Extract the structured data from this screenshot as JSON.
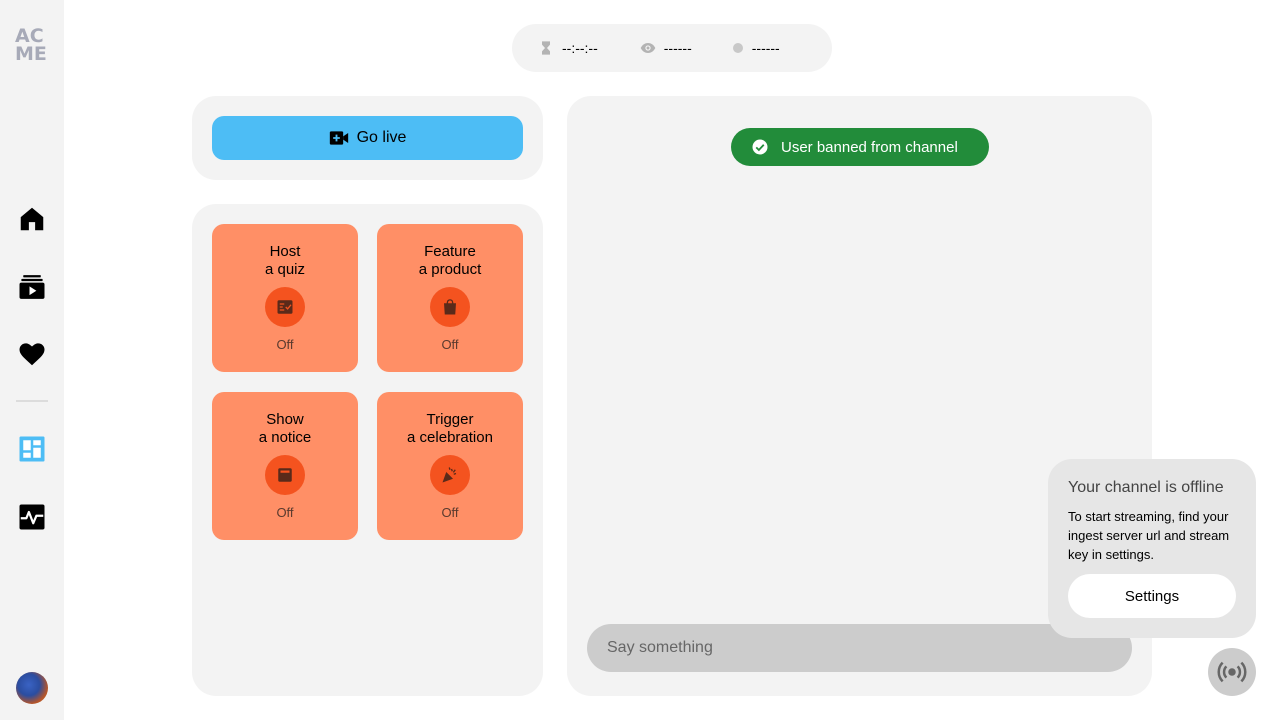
{
  "brand": {
    "logo_line1": "AC",
    "logo_line2": "ME",
    "logo_color": "#a7aab8"
  },
  "sidebar": {
    "items": [
      {
        "name": "home-icon"
      },
      {
        "name": "videos-icon"
      },
      {
        "name": "favorites-icon"
      },
      {
        "name": "dashboard-icon",
        "active": true,
        "color": "#4dbdf5"
      },
      {
        "name": "activity-icon"
      }
    ]
  },
  "stats": {
    "duration": "--:--:--",
    "viewers": "------",
    "status": "------"
  },
  "golive": {
    "label": "Go live",
    "color": "#4dbdf5"
  },
  "actions": [
    {
      "title_line1": "Host",
      "title_line2": "a quiz",
      "state": "Off",
      "icon": "quiz-icon"
    },
    {
      "title_line1": "Feature",
      "title_line2": "a product",
      "state": "Off",
      "icon": "shopping-bag-icon"
    },
    {
      "title_line1": "Show",
      "title_line2": "a notice",
      "state": "Off",
      "icon": "notice-icon"
    },
    {
      "title_line1": "Trigger",
      "title_line2": "a celebration",
      "state": "Off",
      "icon": "celebration-icon"
    }
  ],
  "action_colors": {
    "card": "#ff8f66",
    "icon_bg": "#f4531f"
  },
  "toast": {
    "text": "User banned from channel",
    "color": "#228c3a"
  },
  "chat": {
    "placeholder": "Say something"
  },
  "offline": {
    "title": "Your channel is offline",
    "text": "To start streaming, find your ingest server url and stream key in settings.",
    "settings_label": "Settings"
  }
}
